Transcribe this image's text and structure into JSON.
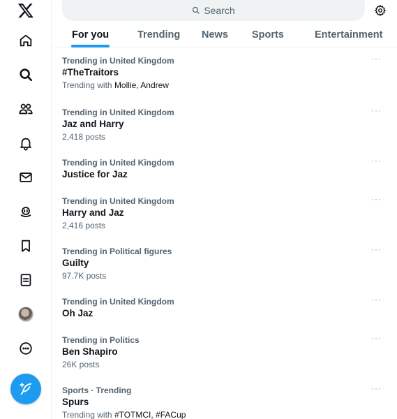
{
  "search": {
    "placeholder": "Search",
    "icon": "search-icon"
  },
  "nav_icons": [
    "x-logo-icon",
    "home-icon",
    "search-icon",
    "communities-icon",
    "notifications-icon",
    "messages-icon",
    "grok-icon",
    "bookmarks-icon",
    "lists-icon",
    "avatar",
    "more-icon"
  ],
  "tabs": [
    {
      "label": "For you",
      "active": true
    },
    {
      "label": "Trending",
      "active": false
    },
    {
      "label": "News",
      "active": false
    },
    {
      "label": "Sports",
      "active": false
    },
    {
      "label": "Entertainment",
      "active": false
    }
  ],
  "trends": [
    {
      "context": "Trending in United Kingdom",
      "name": "#TheTraitors",
      "meta_prefix": "Trending with ",
      "meta_names": "Mollie, Andrew",
      "more": "···"
    },
    {
      "context": "Trending in United Kingdom",
      "name": "Jaz and Harry",
      "meta_prefix": "2,418 posts",
      "meta_names": "",
      "more": "···"
    },
    {
      "context": "Trending in United Kingdom",
      "name": "Justice for Jaz",
      "meta_prefix": "",
      "meta_names": "",
      "more": "···"
    },
    {
      "context": "Trending in United Kingdom",
      "name": "Harry and Jaz",
      "meta_prefix": "2,416 posts",
      "meta_names": "",
      "more": "···"
    },
    {
      "context": "Trending in Political figures",
      "name": "Guilty",
      "meta_prefix": "97.7K posts",
      "meta_names": "",
      "more": "···"
    },
    {
      "context": "Trending in United Kingdom",
      "name": "Oh Jaz",
      "meta_prefix": "",
      "meta_names": "",
      "more": "···"
    },
    {
      "context": "Trending in Politics",
      "name": "Ben Shapiro",
      "meta_prefix": "26K posts",
      "meta_names": "",
      "more": "···"
    },
    {
      "context": "Sports · Trending",
      "name": "Spurs",
      "meta_prefix": "Trending with ",
      "meta_names": "#TOTMCI, #FACup",
      "more": "···"
    }
  ],
  "colors": {
    "accent": "#1d9bf0",
    "text": "#0f1419",
    "secondary": "#536471"
  }
}
